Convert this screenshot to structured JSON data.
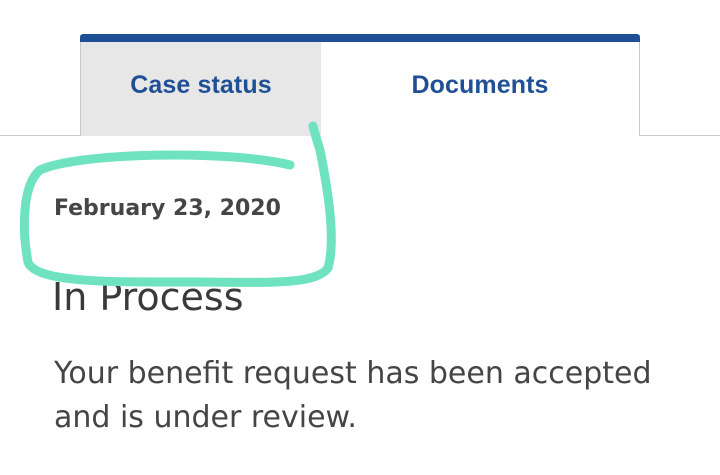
{
  "tabs": {
    "case_status": "Case status",
    "documents": "Documents"
  },
  "case": {
    "date": "February 23, 2020",
    "status_title": "In Process",
    "status_text": "Your benefit request has been accepted and is under review."
  },
  "colors": {
    "brand_blue": "#1f4f95",
    "highlight_mint": "#6fe3c0",
    "inactive_tab_bg": "#e7e7e7"
  }
}
